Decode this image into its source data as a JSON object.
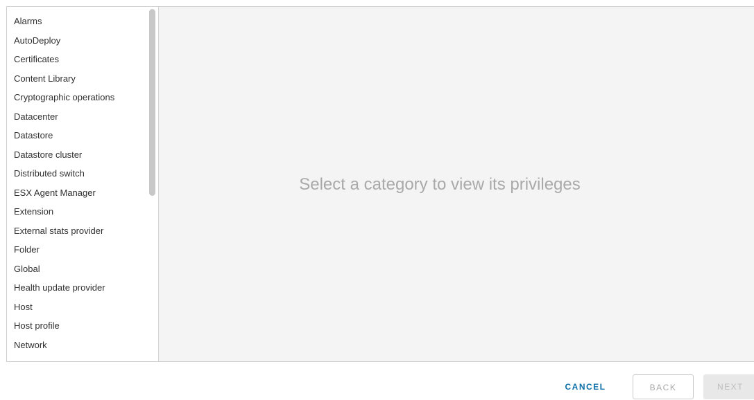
{
  "categories": [
    "Alarms",
    "AutoDeploy",
    "Certificates",
    "Content Library",
    "Cryptographic operations",
    "Datacenter",
    "Datastore",
    "Datastore cluster",
    "Distributed switch",
    "ESX Agent Manager",
    "Extension",
    "External stats provider",
    "Folder",
    "Global",
    "Health update provider",
    "Host",
    "Host profile",
    "Network"
  ],
  "detail": {
    "placeholder": "Select a category to view its privileges"
  },
  "footer": {
    "cancel_label": "CANCEL",
    "back_label": "BACK",
    "next_label": "NEXT"
  },
  "colors": {
    "accent": "#0b6ea8",
    "detail_background": "#f4f4f4",
    "placeholder_text": "#a9a9a9"
  }
}
